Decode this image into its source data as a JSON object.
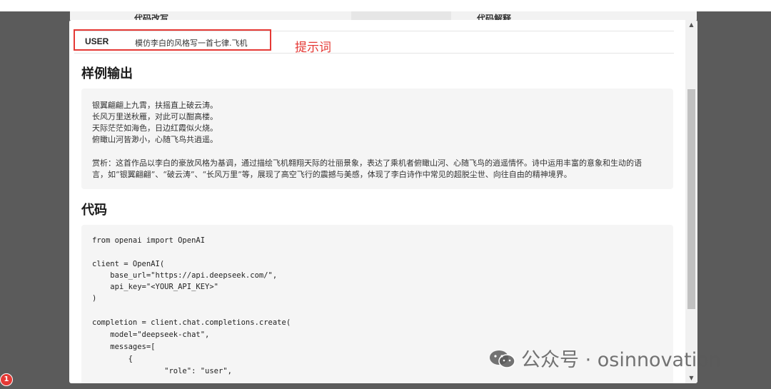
{
  "background_tabs": [
    "代码改写",
    "代码解释"
  ],
  "prompt": {
    "role": "USER",
    "text": "模仿李白的风格写一首七律.飞机",
    "annotation": "提示词"
  },
  "sections": {
    "output_title": "样例输出",
    "code_title": "代码"
  },
  "output_lines": [
    "银翼翩翩上九霄，扶摇直上破云涛。",
    "长风万里送秋雁，对此可以酣高楼。",
    "天际茫茫如海色，日边红霞似火烧。",
    "俯瞰山河皆渺小，心随飞鸟共逍遥。",
    "",
    "赏析：这首作品以李白的豪放风格为基调，通过描绘飞机翱翔天际的壮丽景象，表达了乘机者俯瞰山河、心随飞鸟的逍遥情怀。诗中运用丰富的意象和生动的语",
    "言，如“银翼翩翩”、“破云涛”、“长风万里”等，展现了高空飞行的震撼与美感，体现了李白诗作中常见的超脱尘世、向往自由的精神境界。"
  ],
  "code_lines": [
    "from openai import OpenAI",
    "",
    "client = OpenAI(",
    "    base_url=\"https://api.deepseek.com/\",",
    "    api_key=\"<YOUR_API_KEY>\"",
    ")",
    "",
    "completion = client.chat.completions.create(",
    "    model=\"deepseek-chat\",",
    "    messages=[",
    "        {",
    "                \"role\": \"user\","
  ],
  "watermark": "公众号 · osinnovation",
  "badge_count": "1",
  "colors": {
    "annotation_red": "#e53935",
    "panel_bg": "#f5f5f5",
    "overlay": "#5b5b5b"
  }
}
